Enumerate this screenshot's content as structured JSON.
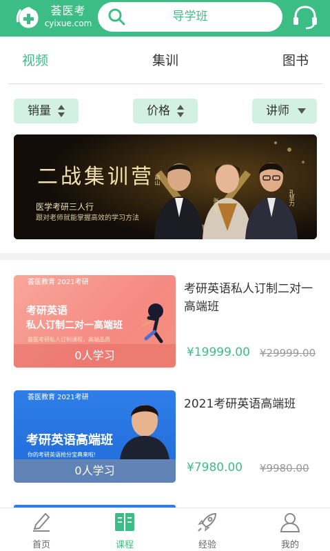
{
  "header": {
    "logo_cn": "荟医考",
    "logo_en": "cyixue.com",
    "search_text": "导学班",
    "brand_color": "#3dbd86",
    "icons": {
      "search": "search-icon",
      "service": "headset-icon"
    }
  },
  "tabs": [
    {
      "label": "视频",
      "active": true
    },
    {
      "label": "集训",
      "active": false
    },
    {
      "label": "图书",
      "active": false
    }
  ],
  "filters": {
    "sales": "销量",
    "price": "价格",
    "teacher": "讲师"
  },
  "banner": {
    "title": "二战集训营",
    "subtitle": "医学考研三人行",
    "tagline": "跟对老师就能掌握高效的学习方法",
    "teachers": [
      "高山",
      "张远方",
      "孔慧力"
    ]
  },
  "courses": [
    {
      "thumb_top": "荟医教育   2021考研",
      "thumb_line1": "考研英语",
      "thumb_line2": "私人订制二对一高端班",
      "thumb_note": "荟医考研私人订制课程，高端品质",
      "learners": "0人学习",
      "title": "考研英语私人订制二对一高端班",
      "price": "¥19999.00",
      "old_price": "¥29999.00"
    },
    {
      "thumb_top": "荟医教育   2021考研",
      "thumb_line1": "考研英语高端班",
      "thumb_note": "你的考研英语抢分宝典来啦!",
      "learners": "0人学习",
      "title": "2021考研英语高端班",
      "price": "¥7980.00",
      "old_price": "¥9980.00"
    }
  ],
  "bottom_nav": [
    {
      "label": "首页",
      "icon": "edit-icon"
    },
    {
      "label": "课程",
      "icon": "book-icon",
      "active": true
    },
    {
      "label": "经验",
      "icon": "rocket-icon"
    },
    {
      "label": "我的",
      "icon": "user-icon"
    }
  ]
}
